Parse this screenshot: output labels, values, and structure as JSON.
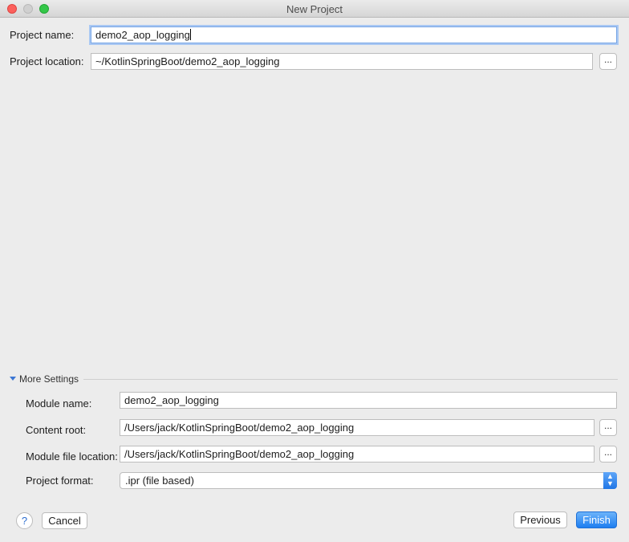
{
  "window": {
    "title": "New Project"
  },
  "project": {
    "name_label": "Project name:",
    "name_value": "demo2_aop_logging",
    "location_label": "Project location:",
    "location_value": "~/KotlinSpringBoot/demo2_aop_logging",
    "browse_label": "..."
  },
  "more_settings": {
    "label": "More Settings",
    "expanded": true,
    "module_name_label": "Module name:",
    "module_name_value": "demo2_aop_logging",
    "content_root_label": "Content root:",
    "content_root_value": "/Users/jack/KotlinSpringBoot/demo2_aop_logging",
    "content_root_browse": "...",
    "module_file_label": "Module file location:",
    "module_file_value": "/Users/jack/KotlinSpringBoot/demo2_aop_logging",
    "module_file_browse": "...",
    "format_label": "Project format:",
    "format_value": ".ipr (file based)"
  },
  "footer": {
    "help_label": "?",
    "cancel_label": "Cancel",
    "previous_label": "Previous",
    "finish_label": "Finish"
  },
  "colors": {
    "accent": "#1e7ef0",
    "focus_ring": "#a9c8f3",
    "close": "#fc605c",
    "maximize": "#34c749"
  }
}
